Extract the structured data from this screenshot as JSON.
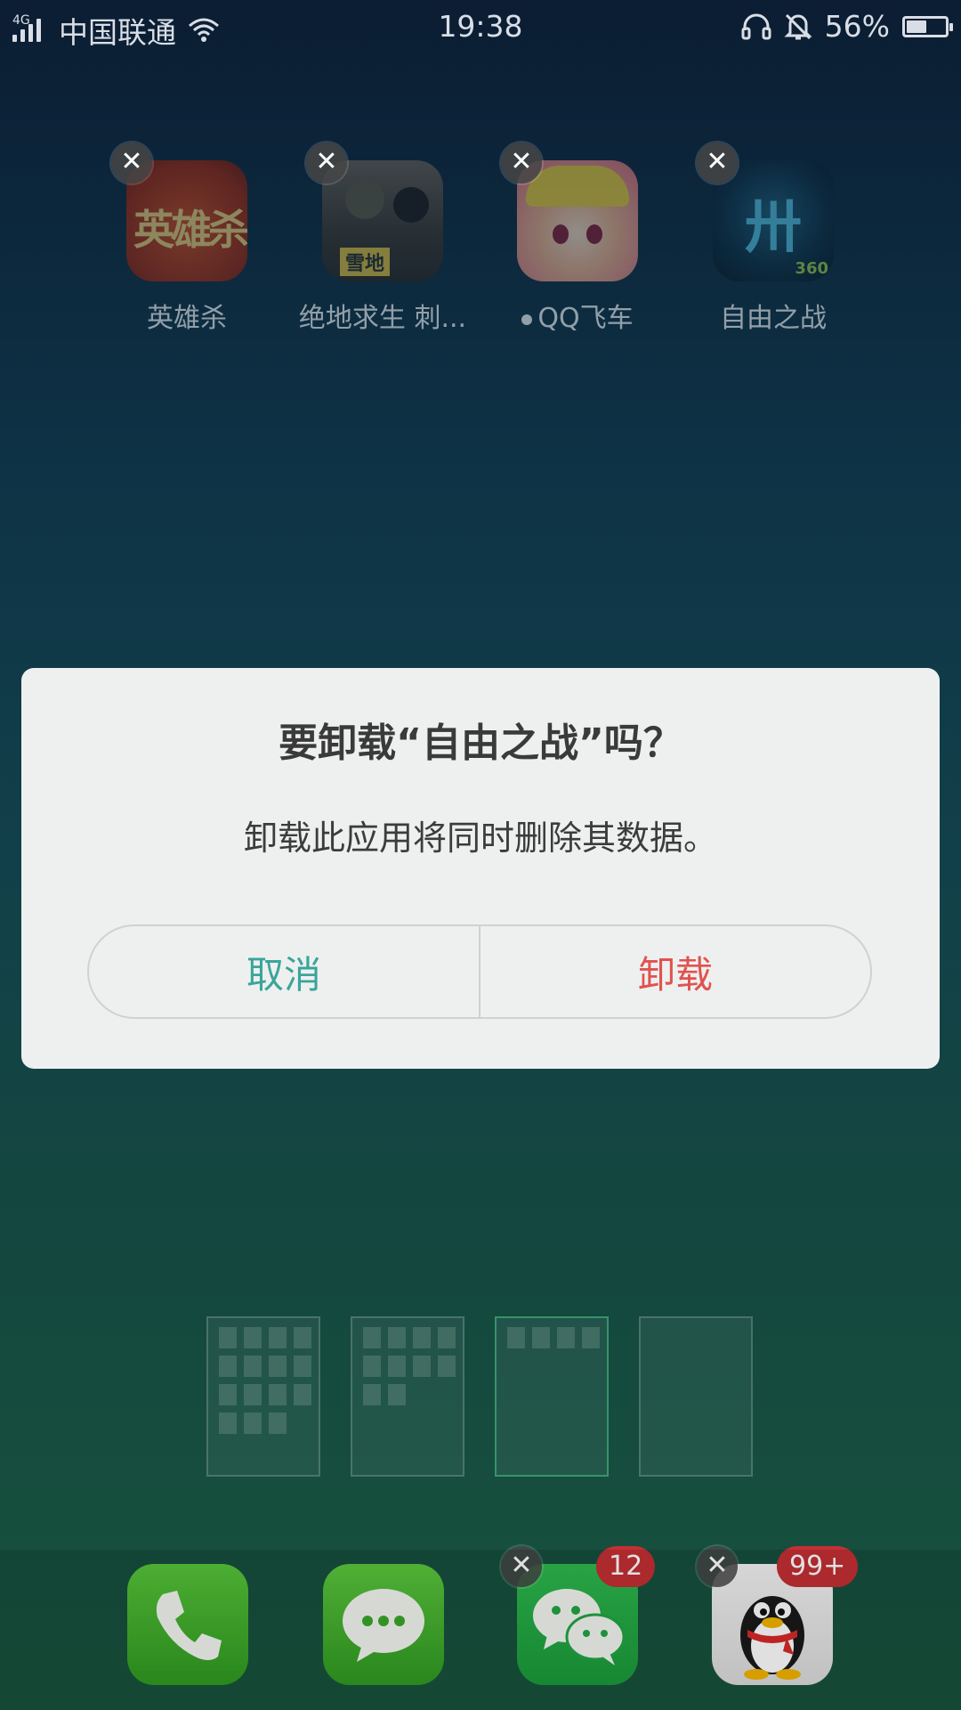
{
  "status_bar": {
    "network_type": "4G",
    "carrier": "中国联通",
    "time": "19:38",
    "battery_percent_label": "56%",
    "battery_level": 0.56
  },
  "folder": {
    "apps": [
      {
        "label": "英雄杀",
        "icon": "yingxiongsha-game-icon",
        "icon_text": "英雄杀"
      },
      {
        "label": "绝地求生 刺...",
        "icon": "pubg-game-icon",
        "icon_text": "雪地"
      },
      {
        "label": "QQ飞车",
        "icon": "qq-speed-game-icon"
      },
      {
        "label": "自由之战",
        "icon": "ziyouzhizhan-game-icon",
        "icon_text": "360"
      }
    ]
  },
  "dialog": {
    "title": "要卸载“自由之战”吗？",
    "message": "卸载此应用将同时删除其数据。",
    "cancel_label": "取消",
    "confirm_label": "卸载",
    "cancel_color": "#3aa59a",
    "confirm_color": "#e0534f"
  },
  "pages": {
    "count": 4,
    "current_index": 2
  },
  "dock": {
    "apps": [
      {
        "name": "phone",
        "icon": "phone-icon"
      },
      {
        "name": "messages",
        "icon": "messages-icon"
      },
      {
        "name": "wechat",
        "icon": "wechat-icon",
        "badge": "12"
      },
      {
        "name": "qq",
        "icon": "qq-penguin-icon",
        "badge": "99+"
      }
    ]
  }
}
